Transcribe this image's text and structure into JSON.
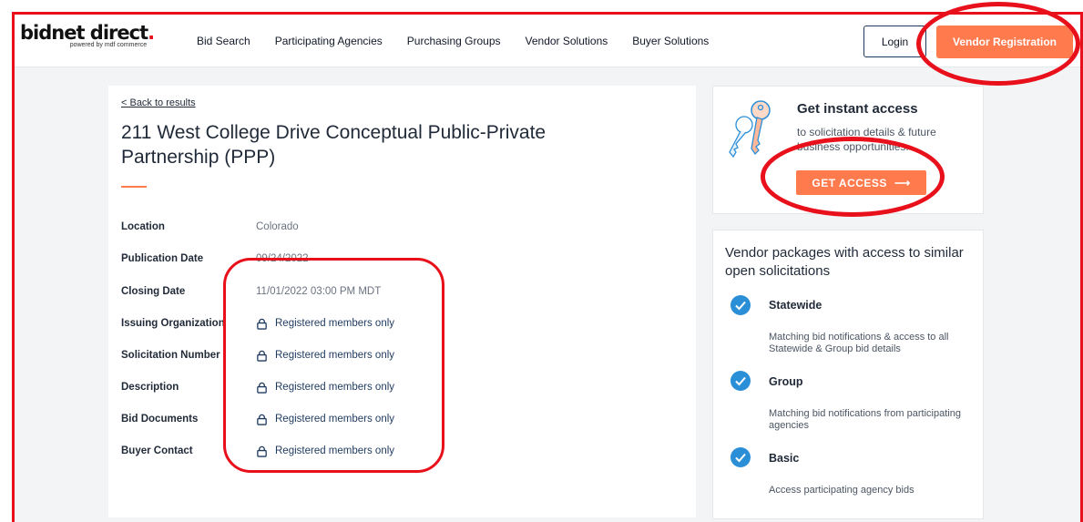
{
  "header": {
    "logo_main": "bidnet direct",
    "logo_dot": ".",
    "logo_sub": "powered by mdf commerce",
    "nav": [
      "Bid Search",
      "Participating Agencies",
      "Purchasing Groups",
      "Vendor Solutions",
      "Buyer Solutions"
    ],
    "login_label": "Login",
    "register_label": "Vendor Registration"
  },
  "main": {
    "back_link": "< Back to results",
    "title": "211 West College Drive Conceptual Public-Private Partnership (PPP)",
    "fields": [
      {
        "label": "Location",
        "value": "Colorado"
      },
      {
        "label": "Publication Date",
        "value": "09/24/2022"
      },
      {
        "label": "Closing Date",
        "value": "11/01/2022 03:00 PM MDT"
      },
      {
        "label": "Issuing Organization",
        "value": "Registered members only"
      },
      {
        "label": "Solicitation Number",
        "value": "Registered members only"
      },
      {
        "label": "Description",
        "value": "Registered members only"
      },
      {
        "label": "Bid Documents",
        "value": "Registered members only"
      },
      {
        "label": "Buyer Contact",
        "value": "Registered members only"
      }
    ]
  },
  "access": {
    "title": "Get instant access",
    "subtitle": "to solicitation details & future business opportunities.",
    "button": "GET ACCESS",
    "arrow": "⟶"
  },
  "packages": {
    "title": "Vendor packages with access to similar open solicitations",
    "items": [
      {
        "name": "Statewide",
        "desc": "Matching bid notifications & access to all Statewide & Group bid details"
      },
      {
        "name": "Group",
        "desc": "Matching bid notifications from participating agencies"
      },
      {
        "name": "Basic",
        "desc": "Access participating agency bids"
      }
    ]
  },
  "colors": {
    "accent": "#ff7a4d",
    "annotation": "#e8101a",
    "check": "#2b8fd8"
  }
}
